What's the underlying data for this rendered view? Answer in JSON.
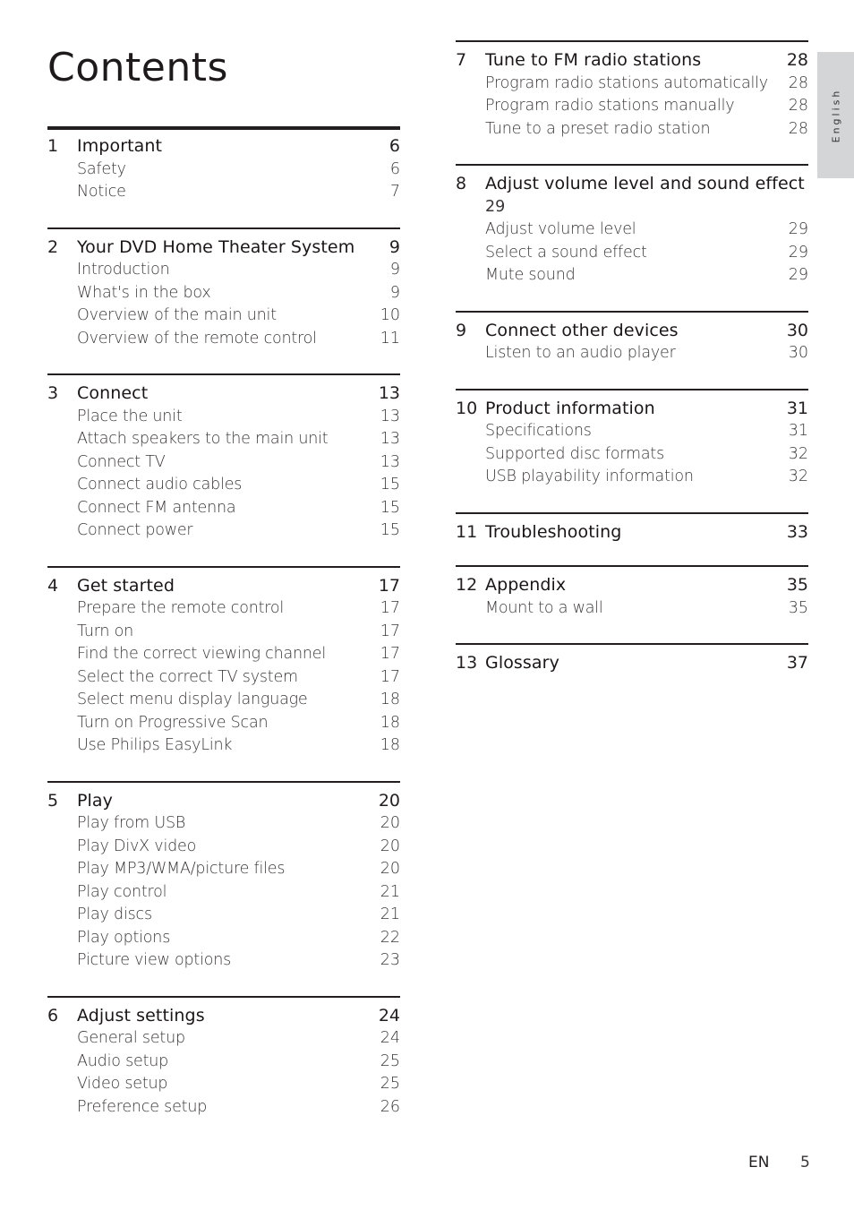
{
  "page_title": "Contents",
  "language_tab": "English",
  "footer": {
    "language_code": "EN",
    "page_number": "5"
  },
  "left_column": [
    {
      "number": "1",
      "title": "Important",
      "page": "6",
      "items": [
        {
          "label": "Safety",
          "page": "6"
        },
        {
          "label": "Notice",
          "page": "7"
        }
      ]
    },
    {
      "number": "2",
      "title": "Your DVD Home Theater System",
      "page": "9",
      "items": [
        {
          "label": "Introduction",
          "page": "9"
        },
        {
          "label": "What's in the box",
          "page": "9"
        },
        {
          "label": "Overview of the main unit",
          "page": "10"
        },
        {
          "label": "Overview of the remote control",
          "page": "11"
        }
      ]
    },
    {
      "number": "3",
      "title": "Connect",
      "page": "13",
      "items": [
        {
          "label": "Place the unit",
          "page": "13"
        },
        {
          "label": "Attach speakers to the main unit",
          "page": "13"
        },
        {
          "label": "Connect TV",
          "page": "13"
        },
        {
          "label": "Connect audio cables",
          "page": "15"
        },
        {
          "label": "Connect FM antenna",
          "page": "15"
        },
        {
          "label": "Connect power",
          "page": "15"
        }
      ]
    },
    {
      "number": "4",
      "title": "Get started",
      "page": "17",
      "items": [
        {
          "label": "Prepare the remote control",
          "page": "17"
        },
        {
          "label": "Turn on",
          "page": "17"
        },
        {
          "label": "Find the correct viewing channel",
          "page": "17"
        },
        {
          "label": "Select the correct TV system",
          "page": "17"
        },
        {
          "label": "Select menu display language",
          "page": "18"
        },
        {
          "label": "Turn on Progressive Scan",
          "page": "18"
        },
        {
          "label": "Use Philips EasyLink",
          "page": "18"
        }
      ]
    },
    {
      "number": "5",
      "title": "Play",
      "page": "20",
      "items": [
        {
          "label": "Play from USB",
          "page": "20"
        },
        {
          "label": "Play DivX video",
          "page": "20"
        },
        {
          "label": "Play MP3/WMA/picture files",
          "page": "20"
        },
        {
          "label": "Play control",
          "page": "21"
        },
        {
          "label": "Play discs",
          "page": "21"
        },
        {
          "label": "Play options",
          "page": "22"
        },
        {
          "label": "Picture view options",
          "page": "23"
        }
      ]
    },
    {
      "number": "6",
      "title": "Adjust settings",
      "page": "24",
      "items": [
        {
          "label": "General setup",
          "page": "24"
        },
        {
          "label": "Audio setup",
          "page": "25"
        },
        {
          "label": "Video setup",
          "page": "25"
        },
        {
          "label": "Preference setup",
          "page": "26"
        }
      ]
    }
  ],
  "right_column": [
    {
      "number": "7",
      "title": "Tune to FM radio stations",
      "page": "28",
      "items": [
        {
          "label": "Program radio stations automatically",
          "page": "28"
        },
        {
          "label": "Program radio stations manually",
          "page": "28"
        },
        {
          "label": "Tune to a preset radio station",
          "page": "28"
        }
      ]
    },
    {
      "number": "8",
      "title": "Adjust volume level and sound effect",
      "page": "29",
      "items": [
        {
          "label": "Adjust volume level",
          "page": "29"
        },
        {
          "label": "Select a sound effect",
          "page": "29"
        },
        {
          "label": "Mute sound",
          "page": "29"
        }
      ]
    },
    {
      "number": "9",
      "title": "Connect other devices",
      "page": "30",
      "items": [
        {
          "label": "Listen to an audio player",
          "page": "30"
        }
      ]
    },
    {
      "number": "10",
      "title": "Product information",
      "page": "31",
      "items": [
        {
          "label": "Specifications",
          "page": "31"
        },
        {
          "label": "Supported disc formats",
          "page": "32"
        },
        {
          "label": "USB playability information",
          "page": "32"
        }
      ]
    },
    {
      "number": "11",
      "title": "Troubleshooting",
      "page": "33",
      "items": []
    },
    {
      "number": "12",
      "title": "Appendix",
      "page": "35",
      "items": [
        {
          "label": "Mount to a wall",
          "page": "35"
        }
      ]
    },
    {
      "number": "13",
      "title": "Glossary",
      "page": "37",
      "items": []
    }
  ]
}
